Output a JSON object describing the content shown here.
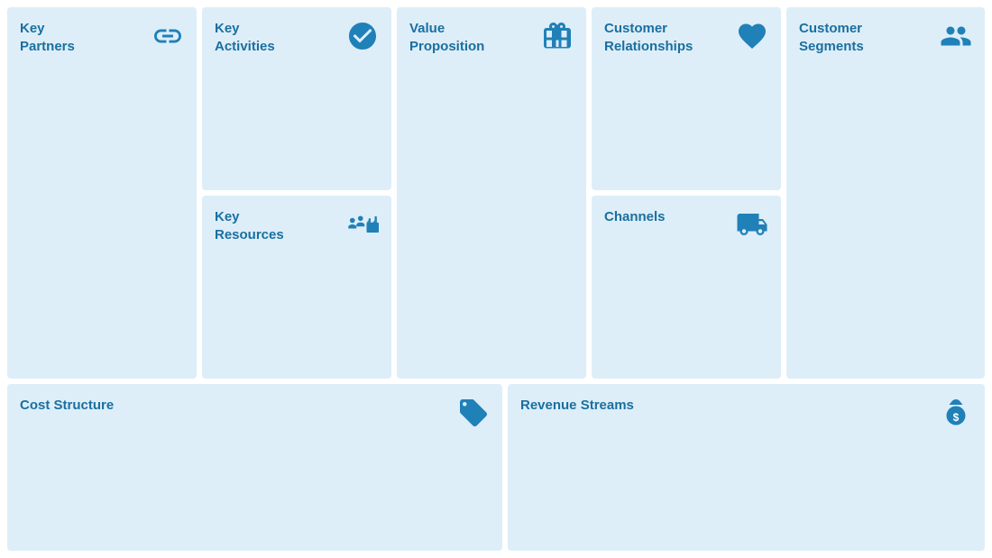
{
  "cells": {
    "key_partners": {
      "title": "Key\nPartners",
      "icon": "link"
    },
    "key_activities": {
      "title": "Key\nActivities",
      "icon": "check-circle"
    },
    "key_resources": {
      "title": "Key\nResources",
      "icon": "factory-people"
    },
    "value_proposition": {
      "title": "Value\nProposition",
      "icon": "gift"
    },
    "customer_relationships": {
      "title": "Customer\nRelationships",
      "icon": "heart"
    },
    "channels": {
      "title": "Channels",
      "icon": "truck"
    },
    "customer_segments": {
      "title": "Customer\nSegments",
      "icon": "people"
    },
    "cost_structure": {
      "title": "Cost Structure",
      "icon": "tag"
    },
    "revenue_streams": {
      "title": "Revenue Streams",
      "icon": "money-bag"
    }
  }
}
